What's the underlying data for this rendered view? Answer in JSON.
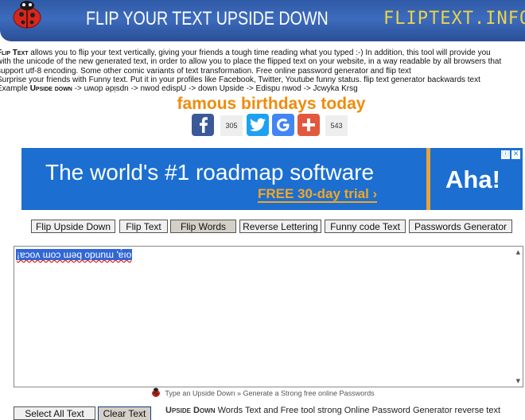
{
  "header": {
    "title": "FLIP YOUR TEXT UPSIDE DOWN",
    "brand": "FLIPTEXT.INFO"
  },
  "intro": {
    "line1_bold": "Flip Text",
    "line1_rest": " allows you to flip your text vertically, giving your friends a tough time reading what you typed :-) In addition, this tool will provide you",
    "line2": "with the unicode of the new generated text, in order to allow you to place the flipped text on your website, in a way readable by all browsers that",
    "line3": "support utf-8 encoding. Some other comic variants of text transformation. Free online password generator and flip text",
    "line4": "Surprise your friends with Funny text. Put it in your profiles like Facebook, Twitter, Youtube funny status. flip text generator backwards text",
    "line5_prefix": "Example ",
    "line5_bold": "Upside down",
    "line5_rest": " -> uʍop ǝpᴉsdn -> nwod edispU -> down Upside -> Edispu nwod -> Jcwyka Krsg"
  },
  "famous": "famous birthdays today",
  "share": {
    "facebook_count": "305",
    "plus_count": "543"
  },
  "ad": {
    "headline": "The world's #1 roadmap software",
    "cta": "FREE 30-day trial ›",
    "logo": "Aha!"
  },
  "tools": [
    "Flip Upside Down",
    "Flip Text",
    "Flip Words",
    "Reverse Lettering",
    "Funny code Text",
    "Passwords Generator"
  ],
  "textarea": {
    "value": "¡ɐɔoʌ ɯoɔ ɯǝq opunɯ 'ɐ́ıo"
  },
  "footer": {
    "line": "Type an Upside Down » Generate a Strong free online Passwords",
    "select_all": "Select All Text",
    "clear": "Clear Text",
    "bottom_bold": "Upside Down",
    "bottom_rest": " Words Text and Free tool strong Online Password Generator reverse text"
  },
  "colors": {
    "header_blue": "#3d6bbd",
    "brand_yellow": "#e8d44a",
    "famous_orange": "#f08b0a",
    "ad_blue": "#1c6fd0",
    "ad_orange": "#f5a623"
  }
}
